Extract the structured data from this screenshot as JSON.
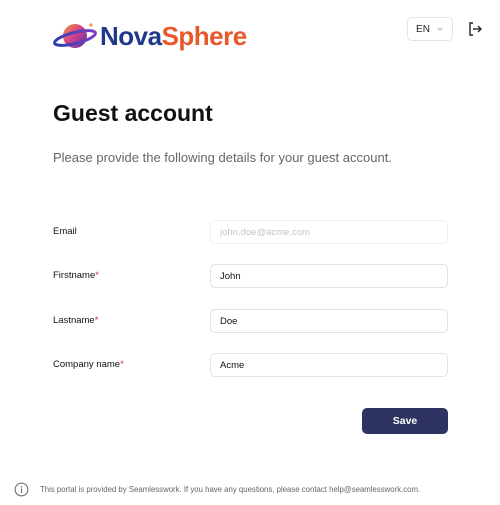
{
  "header": {
    "brand_part1": "Nova",
    "brand_part2": "Sphere",
    "language": "EN",
    "logo_icon": "planet-icon",
    "logout_icon": "logout-icon"
  },
  "page": {
    "title": "Guest account",
    "subtitle": "Please provide the following details for your guest account."
  },
  "form": {
    "email": {
      "label": "Email",
      "value": "",
      "placeholder": "john.doe@acme.com"
    },
    "firstname": {
      "label": "Firstname",
      "required_mark": "*",
      "value": "John"
    },
    "lastname": {
      "label": "Lastname",
      "required_mark": "*",
      "value": "Doe"
    },
    "company": {
      "label": "Company name",
      "required_mark": "*",
      "value": "Acme"
    },
    "save_label": "Save"
  },
  "footer": {
    "text": "This portal is provided by Seamlesswork. If you have any questions, please contact help@seamlesswork.com.",
    "icon": "info-icon"
  },
  "colors": {
    "brand_blue": "#1f3a8a",
    "brand_orange": "#e8582b",
    "primary_button": "#2e3361",
    "required": "#d32f2f"
  }
}
